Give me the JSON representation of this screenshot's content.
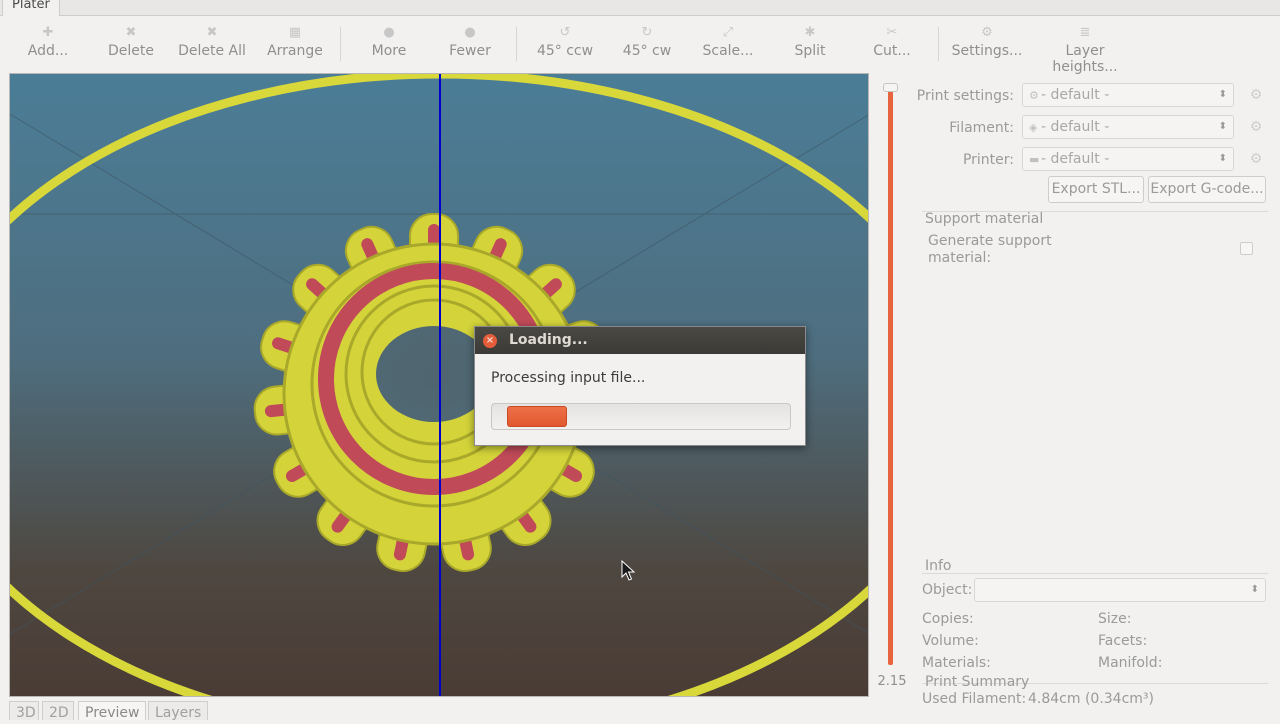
{
  "window": {
    "tab": "Plater"
  },
  "toolbar": {
    "add": "Add...",
    "delete": "Delete",
    "delete_all": "Delete All",
    "arrange": "Arrange",
    "more": "More",
    "fewer": "Fewer",
    "rotate_ccw": "45° ccw",
    "rotate_cw": "45° cw",
    "scale": "Scale...",
    "split": "Split",
    "cut": "Cut...",
    "settings": "Settings...",
    "layer_heights": "Layer heights..."
  },
  "layer_slider": {
    "value_label": "2.15",
    "level": 1.0
  },
  "settings": {
    "print_label": "Print settings:",
    "print_value": "- default -",
    "filament_label": "Filament:",
    "filament_value": "- default -",
    "printer_label": "Printer:",
    "printer_value": "- default -",
    "export_stl": "Export STL...",
    "export_gcode": "Export G-code..."
  },
  "support": {
    "title": "Support material",
    "generate_line1": "Generate support",
    "generate_line2": "material:",
    "checked": false
  },
  "info": {
    "title": "Info",
    "object_label": "Object:",
    "copies": "Copies:",
    "size": "Size:",
    "volume": "Volume:",
    "facets": "Facets:",
    "materials": "Materials:",
    "manifold": "Manifold:"
  },
  "summary": {
    "title": "Print Summary",
    "used_filament_label": "Used Filament:",
    "used_filament_value": "4.84cm (0.34cm³)"
  },
  "view_tabs": [
    "3D",
    "2D",
    "Preview",
    "Layers"
  ],
  "active_view_tab": "Preview",
  "dialog": {
    "title": "Loading...",
    "message": "Processing input file...",
    "progress": 0.2
  },
  "colors": {
    "accent": "#e8643e",
    "extrusion": "#d4d43a",
    "perimeter": "#c04a58",
    "cut_line": "#0000cc"
  }
}
